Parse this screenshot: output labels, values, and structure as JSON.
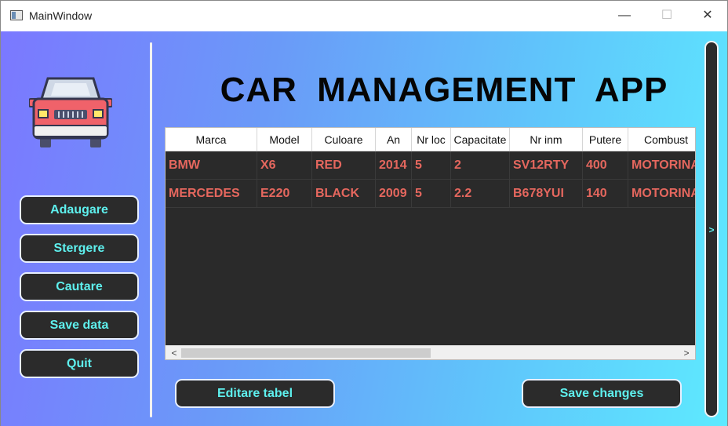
{
  "window": {
    "title": "MainWindow",
    "min_glyph": "—",
    "max_glyph": "☐",
    "close_glyph": "✕"
  },
  "sidebar": {
    "buttons": [
      "Adaugare",
      "Stergere",
      "Cautare",
      "Save data",
      "Quit"
    ]
  },
  "app_title": "CAR  MANAGEMENT  APP",
  "table": {
    "columns": [
      "Marca",
      "Model",
      "Culoare",
      "An",
      "Nr loc",
      "Capacitate",
      "Nr inm",
      "Putere",
      "Combust"
    ],
    "rows": [
      [
        "BMW",
        "X6",
        "RED",
        "2014",
        "5",
        "2",
        "SV12RTY",
        "400",
        "MOTORINA"
      ],
      [
        "MERCEDES",
        "E220",
        "BLACK",
        "2009",
        "5",
        "2.2",
        "B678YUI",
        "140",
        "MOTORINA"
      ]
    ],
    "scroll_left": "<",
    "scroll_right": ">"
  },
  "bottom_buttons": {
    "edit_table": "Editare tabel",
    "save_changes": "Save changes"
  },
  "right_panel": {
    "arrow": ">"
  },
  "colors": {
    "accent_text": "#5ef0ee",
    "cell_text": "#e5675e",
    "button_bg": "#2b2b2b",
    "table_bg": "#2a2a2a"
  }
}
